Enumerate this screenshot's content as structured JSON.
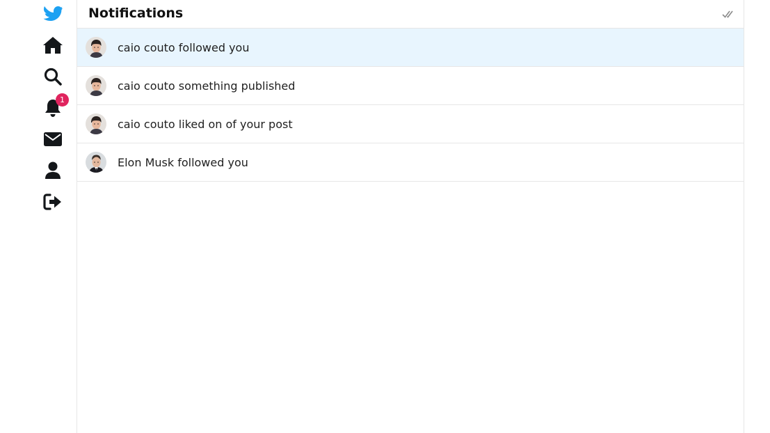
{
  "nav": {
    "items": [
      {
        "name": "logo",
        "icon": "bird-logo-icon"
      },
      {
        "name": "home",
        "icon": "home-icon"
      },
      {
        "name": "search",
        "icon": "search-icon"
      },
      {
        "name": "notifications",
        "icon": "bell-icon",
        "badge": "1"
      },
      {
        "name": "messages",
        "icon": "envelope-icon"
      },
      {
        "name": "profile",
        "icon": "user-icon"
      },
      {
        "name": "logout",
        "icon": "sign-out-icon"
      }
    ]
  },
  "header": {
    "title": "Notifications",
    "action_icon": "double-check-icon"
  },
  "notifications": [
    {
      "text": "caio couto followed you",
      "unread": true,
      "avatar": "caio-avatar"
    },
    {
      "text": "caio couto something published",
      "unread": false,
      "avatar": "caio-avatar"
    },
    {
      "text": "caio couto liked on of your post",
      "unread": false,
      "avatar": "caio-avatar"
    },
    {
      "text": "Elon Musk followed you",
      "unread": false,
      "avatar": "elon-avatar"
    }
  ],
  "colors": {
    "brand": "#1da1f2",
    "badge": "#e0245e",
    "unread_bg": "#e8f5fe",
    "icon": "#14171a",
    "divider": "#e6e6e6"
  }
}
